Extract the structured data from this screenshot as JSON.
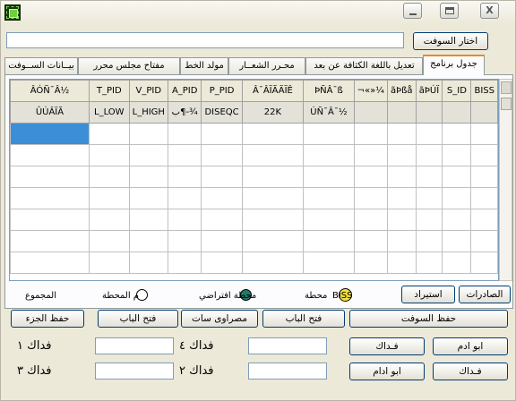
{
  "window": {
    "icon": "chip-icon",
    "controls": {
      "minimize": "minimize-icon",
      "maximize": "maximize-icon",
      "close": "X"
    }
  },
  "top": {
    "choose_sofat_button": "اختار السوفت",
    "file_path_value": ""
  },
  "tabs": [
    {
      "label": "جدول برنامج",
      "active": true
    },
    {
      "label": "تعديل باللغة الكثافة عن بعد",
      "active": false
    },
    {
      "label": "محـرر الشعــار",
      "active": false
    },
    {
      "label": "مولد الخط",
      "active": false
    },
    {
      "label": "مفتاح مجلس محرر",
      "active": false
    },
    {
      "label": "بيــانات الســوفت",
      "active": false
    }
  ],
  "table": {
    "headers": [
      "BISS",
      "S_ID",
      "ãÞÚÏ",
      "ãÞßå",
      "¬«»¼",
      "ÞÑÂ¯ß",
      "Â¯ÂÏÃÄÏÊ",
      "P_PID",
      "A_PID",
      "V_PID",
      "T_PID",
      "ÂÓÑ¯Â½"
    ],
    "fixed_row": [
      "",
      "",
      "",
      "",
      "",
      "ÚÑ¯Â¯½",
      "22K",
      "DISEQC",
      "ب¶-¾",
      "L_HIGH",
      "L_LOW",
      "ÛÚÂÏÃ"
    ]
  },
  "bottom": {
    "exports_button": "الصادرات",
    "import_button": "استيراد",
    "legend_biss_circle_text": "BISS",
    "legend_biss_label": "محطة",
    "legend_default_label": "محطة افتراضي",
    "legend_station_label": "م المحطة",
    "total_label": "المجموع",
    "save_sofat_button": "حفظ السوفت",
    "open_door_button_1": "فتح الباب",
    "masrawy_sat_button": "مصراوى سات",
    "open_door_button_2": "فتح الباب",
    "save_part_button": "حفظ الجزء",
    "abu_adam_button_1": "ابو ادم",
    "fedak_button_1": "فـداك",
    "fedak_button_2": "فـداك",
    "abu_adam_button_2": "ابو ادام",
    "fedak_1_label": "فداك ١",
    "fedak_4_label": "فداك ٤",
    "fedak_3_label": "فداك ٣",
    "fedak_2_label": "فداك ٢",
    "field_values": {
      "f1": "",
      "f2": "",
      "f3": "",
      "f4": "",
      "f5": "",
      "f6": ""
    }
  },
  "colors": {
    "selection": "#3c8fd6",
    "biss_circle": "#f5e03a",
    "default_circle": "#1f7a68",
    "active_tab_accent": "#e68b2c"
  }
}
